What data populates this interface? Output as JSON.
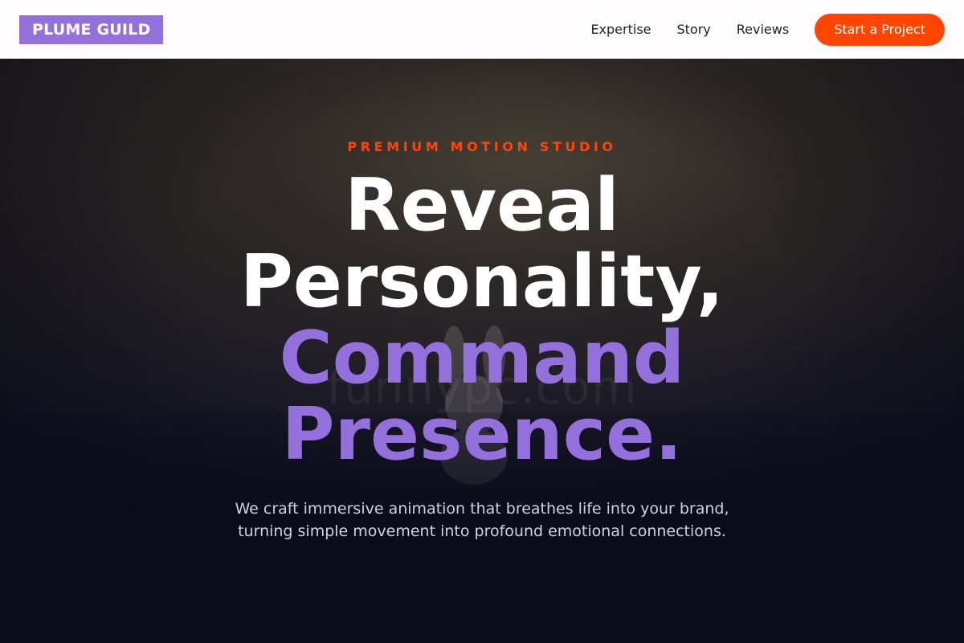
{
  "header": {
    "logo": "PLUME GUILD",
    "nav": [
      {
        "label": "Expertise"
      },
      {
        "label": "Story"
      },
      {
        "label": "Reviews"
      }
    ],
    "cta_label": "Start a Project"
  },
  "hero": {
    "eyebrow": "PREMIUM MOTION STUDIO",
    "headline_lines": [
      "Reveal",
      "Personality,"
    ],
    "headline_accent_lines": [
      "Command",
      "Presence."
    ],
    "subtext_lines": [
      "We craft immersive animation that breathes life into your brand,",
      "turning simple movement into profound emotional connections."
    ],
    "watermark": "funnypc.com"
  },
  "colors": {
    "brand_purple": "#9370db",
    "accent_orange": "#ff4500",
    "header_bg": "#fefcfd",
    "hero_dark": "#0a0b1a"
  }
}
